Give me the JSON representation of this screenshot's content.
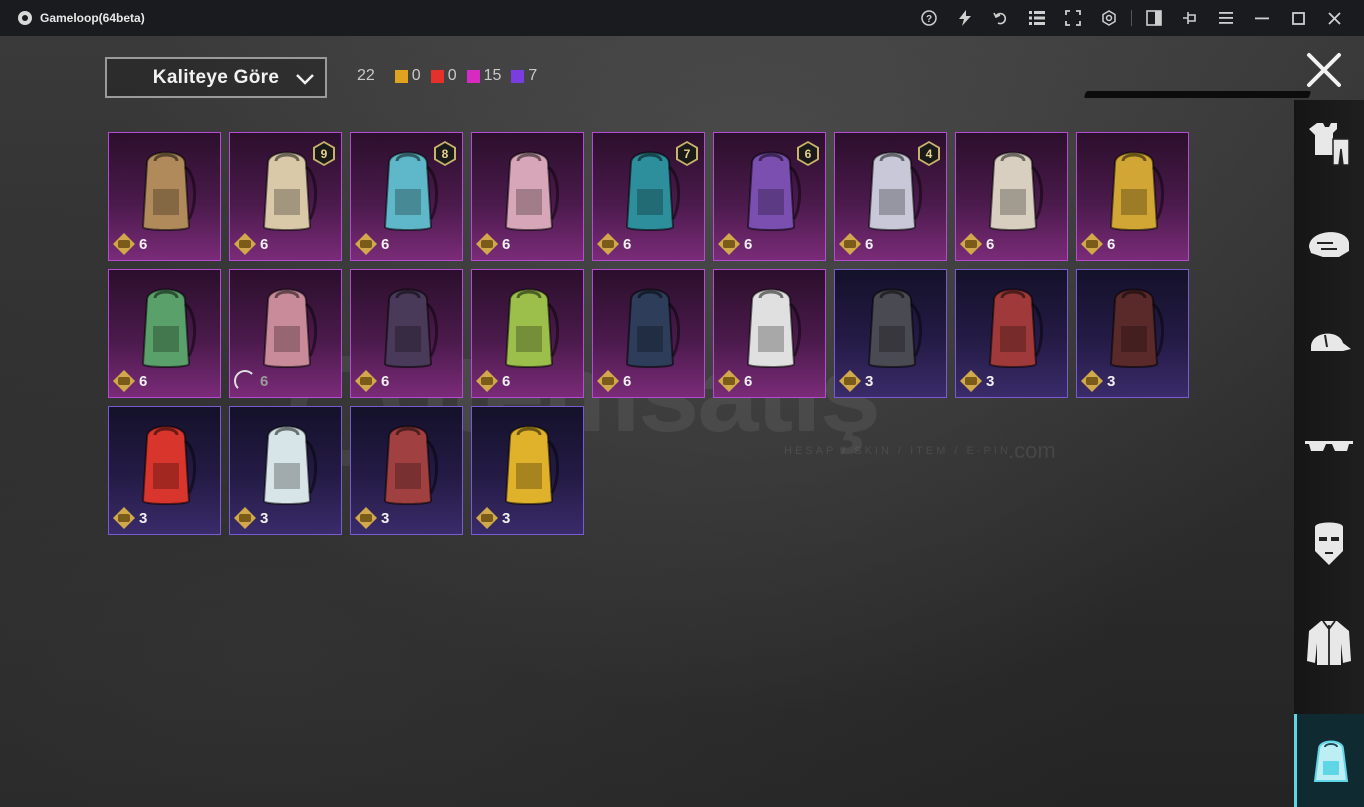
{
  "window": {
    "title": "Gameloop(64beta)",
    "icons": [
      "help-icon",
      "boost-icon",
      "rotate-icon",
      "menu-grid-icon",
      "fullscreen-icon",
      "settings-icon",
      "sidebar-toggle-icon",
      "pin-icon",
      "hamburger-icon",
      "minimize-icon",
      "maximize-icon",
      "close-icon"
    ]
  },
  "filter": {
    "label": "Kaliteye Göre",
    "total": "22",
    "counts": [
      {
        "color": "#e0a31f",
        "value": "0"
      },
      {
        "color": "#e5312a",
        "value": "0"
      },
      {
        "color": "#d62ac2",
        "value": "15"
      },
      {
        "color": "#7a3de0",
        "value": "7"
      }
    ]
  },
  "sidebar": {
    "items": [
      {
        "icon": "outfit-icon",
        "active": false
      },
      {
        "icon": "helmet-icon",
        "active": false
      },
      {
        "icon": "cap-icon",
        "active": false
      },
      {
        "icon": "glasses-icon",
        "active": false
      },
      {
        "icon": "mask-icon",
        "active": false
      },
      {
        "icon": "jacket-icon",
        "active": false
      },
      {
        "icon": "backpack-icon",
        "active": true
      }
    ]
  },
  "items": [
    {
      "count": "6",
      "level": "",
      "rarity": "mythic",
      "color": "#b08a5a"
    },
    {
      "count": "6",
      "level": "9",
      "rarity": "mythic",
      "color": "#d9c9a8"
    },
    {
      "count": "6",
      "level": "8",
      "rarity": "mythic",
      "color": "#5fb8c9"
    },
    {
      "count": "6",
      "level": "",
      "rarity": "mythic",
      "color": "#d7a7b9"
    },
    {
      "count": "6",
      "level": "7",
      "rarity": "mythic",
      "color": "#2e8f9c"
    },
    {
      "count": "6",
      "level": "6",
      "rarity": "mythic",
      "color": "#7b4fb0"
    },
    {
      "count": "6",
      "level": "4",
      "rarity": "mythic",
      "color": "#c8c8d8"
    },
    {
      "count": "6",
      "level": "",
      "rarity": "mythic",
      "color": "#d8cfc0"
    },
    {
      "count": "6",
      "level": "",
      "rarity": "mythic",
      "color": "#d1a634"
    },
    {
      "count": "6",
      "level": "",
      "rarity": "mythic",
      "color": "#5aa06a"
    },
    {
      "count": "6",
      "level": "",
      "rarity": "mythic",
      "color": "#c98a9a",
      "loading": true
    },
    {
      "count": "6",
      "level": "",
      "rarity": "mythic",
      "color": "#4a3a5a"
    },
    {
      "count": "6",
      "level": "",
      "rarity": "mythic",
      "color": "#9bbf4a"
    },
    {
      "count": "6",
      "level": "",
      "rarity": "mythic",
      "color": "#2d3d5a"
    },
    {
      "count": "6",
      "level": "",
      "rarity": "mythic",
      "color": "#e0e0e0"
    },
    {
      "count": "3",
      "level": "",
      "rarity": "legend",
      "color": "#4a4a52"
    },
    {
      "count": "3",
      "level": "",
      "rarity": "legend",
      "color": "#a03a3a"
    },
    {
      "count": "3",
      "level": "",
      "rarity": "legend",
      "color": "#5a2a2a"
    },
    {
      "count": "3",
      "level": "",
      "rarity": "legend",
      "color": "#d8352c"
    },
    {
      "count": "3",
      "level": "",
      "rarity": "legend",
      "color": "#d7e4e8"
    },
    {
      "count": "3",
      "level": "",
      "rarity": "legend",
      "color": "#a04040"
    },
    {
      "count": "3",
      "level": "",
      "rarity": "legend",
      "color": "#e0b12a"
    }
  ],
  "watermark": {
    "text": "itemsatış",
    "subtitle": "HESAP / SKIN / ITEM / E-PIN",
    "suffix": ".com"
  }
}
